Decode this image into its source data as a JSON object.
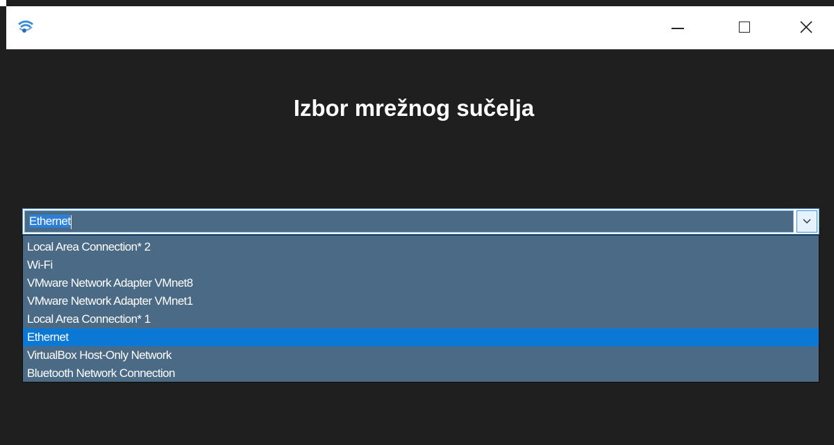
{
  "window": {
    "controls": {
      "minimize_icon": "minimize-icon",
      "maximize_icon": "maximize-icon",
      "close_icon": "close-icon"
    },
    "app_icon": "wifi-globe-icon"
  },
  "main": {
    "heading": "Izbor mrežnog sučelja",
    "combobox": {
      "value": "Ethernet",
      "arrow_icon": "chevron-down-icon",
      "options": [
        "Local Area Connection* 2",
        "Wi-Fi",
        "VMware Network Adapter VMnet8",
        "VMware Network Adapter VMnet1",
        "Local Area Connection* 1",
        "Ethernet",
        "VirtualBox Host-Only Network",
        "Bluetooth Network Connection"
      ],
      "selected_index": 5
    }
  },
  "colors": {
    "background": "#1f1f1f",
    "dropdown": "#4a6a86",
    "selected": "#0a78d4",
    "accent_border": "#3a8ddb"
  }
}
